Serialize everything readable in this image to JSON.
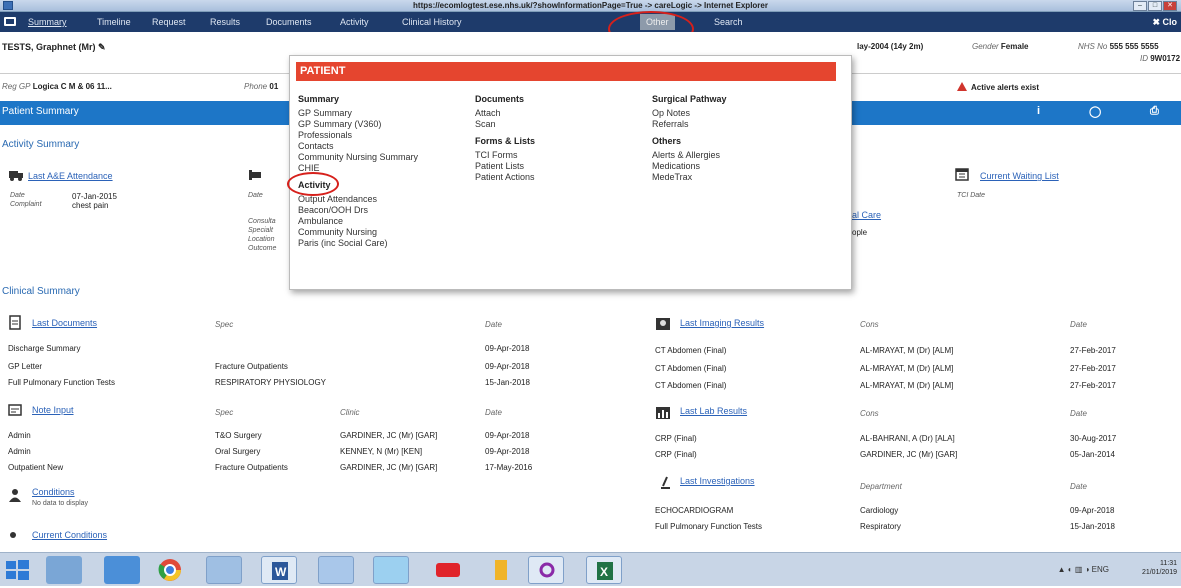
{
  "window": {
    "title": "https://ecomlogtest.ese.nhs.uk/?showInformationPage=True -> careLogic -> Internet Explorer",
    "min": "–",
    "max": "□",
    "close": "✕"
  },
  "nav": {
    "items": [
      "Summary",
      "Timeline",
      "Request",
      "Results",
      "Documents",
      "Activity",
      "Clinical History",
      "Other",
      "Search"
    ],
    "close_label": "✖ Clo"
  },
  "patient": {
    "name": "TESTS, Graphnet (Mr)",
    "dob": "lay-2004 (14y 2m)",
    "gender_label": "Gender",
    "gender": "Female",
    "nhs_label": "NHS No",
    "nhs": "555 555 5555",
    "id_label": "ID",
    "id": "9W0172",
    "gp_label": "Reg GP",
    "gp": "Logica C M & 06 11...",
    "phone_label": "Phone",
    "phone": "01"
  },
  "alert_text": "Active alerts exist",
  "summary_header": "Patient Summary",
  "activity_summary": "Activity Summary",
  "clinical_summary": "Clinical Summary",
  "ae": {
    "title": "Last A&E Attendance",
    "date_label": "Date",
    "date": "07-Jan-2015",
    "complaint_label": "Complaint",
    "complaint": "chest pain"
  },
  "ip": {
    "date_label": "Date",
    "consultant_label": "Consulta",
    "specialty_label": "Specialt",
    "location_label": "Location",
    "outcome_label": "Outcome"
  },
  "mid_partial": {
    "care": "al Care",
    "chip": "ople"
  },
  "waiting": {
    "title": "Current Waiting List",
    "tci_label": "TCI Date"
  },
  "dropdown": {
    "header": "PATIENT",
    "col1": {
      "heading": "Summary",
      "items": [
        "GP Summary",
        "GP Summary (V360)",
        "Professionals",
        "Contacts",
        "Community Nursing Summary",
        "CHIE"
      ],
      "heading2": "Activity",
      "items2": [
        "Output Attendances",
        "Beacon/OOH Drs",
        "Ambulance",
        "Community Nursing",
        "Paris (inc Social Care)"
      ]
    },
    "col2": {
      "heading": "Documents",
      "items": [
        "Attach",
        "Scan"
      ],
      "heading2": "Forms & Lists",
      "items2": [
        "TCI Forms",
        "Patient Lists",
        "Patient Actions"
      ]
    },
    "col3": {
      "heading": "Surgical Pathway",
      "items": [
        "Op Notes",
        "Referrals"
      ],
      "heading2": "Others",
      "items2": [
        "Alerts & Allergies",
        "Medications",
        "MedeTrax"
      ]
    }
  },
  "last_documents": {
    "title": "Last Documents",
    "headers": [
      "Spec",
      "Date"
    ],
    "rows": [
      [
        "Discharge Summary",
        "",
        "09-Apr-2018"
      ],
      [
        "GP Letter",
        "Fracture Outpatients",
        "09-Apr-2018"
      ],
      [
        "Full Pulmonary Function Tests",
        "RESPIRATORY PHYSIOLOGY",
        "15-Jan-2018"
      ]
    ]
  },
  "notes": {
    "title": "Note Input",
    "headers": [
      "Spec",
      "Clinic",
      "Date"
    ],
    "rows": [
      [
        "Admin",
        "T&O Surgery",
        "GARDINER, JC (Mr) [GAR]",
        "09-Apr-2018"
      ],
      [
        "Admin",
        "Oral Surgery",
        "KENNEY, N (Mr) [KEN]",
        "09-Apr-2018"
      ],
      [
        "Outpatient New",
        "Fracture Outpatients",
        "GARDINER, JC (Mr) [GAR]",
        "17-May-2016"
      ]
    ]
  },
  "conditions": {
    "title": "Conditions",
    "empty": "No data to display"
  },
  "current_conditions": {
    "title": "Current Conditions"
  },
  "imaging": {
    "title": "Last Imaging Results",
    "headers": [
      "Cons",
      "Date"
    ],
    "rows": [
      [
        "CT Abdomen (Final)",
        "AL-MRAYAT, M (Dr) [ALM]",
        "27-Feb-2017"
      ],
      [
        "CT Abdomen (Final)",
        "AL-MRAYAT, M (Dr) [ALM]",
        "27-Feb-2017"
      ],
      [
        "CT Abdomen (Final)",
        "AL-MRAYAT, M (Dr) [ALM]",
        "27-Feb-2017"
      ]
    ]
  },
  "lab": {
    "title": "Last Lab Results",
    "headers": [
      "Cons",
      "Date"
    ],
    "rows": [
      [
        "CRP (Final)",
        "AL-BAHRANI, A (Dr) [ALA]",
        "30-Aug-2017"
      ],
      [
        "CRP (Final)",
        "GARDINER, JC (Mr) [GAR]",
        "05-Jan-2014"
      ]
    ]
  },
  "investigations": {
    "title": "Last Investigations",
    "headers": [
      "Department",
      "Date"
    ],
    "rows": [
      [
        "ECHOCARDIOGRAM",
        "Cardiology",
        "09-Apr-2018"
      ],
      [
        "Full Pulmonary Function Tests",
        "Respiratory",
        "15-Jan-2018"
      ]
    ]
  },
  "taskbar": {
    "lang": "ENG",
    "time": "11:31",
    "date": "21/01/2019"
  },
  "colors": {
    "nav": "#1e3b6b",
    "header": "#1d76c7",
    "dropdown_bar": "#e5452f",
    "highlight": "#d6201b",
    "link": "#2b62b8"
  }
}
